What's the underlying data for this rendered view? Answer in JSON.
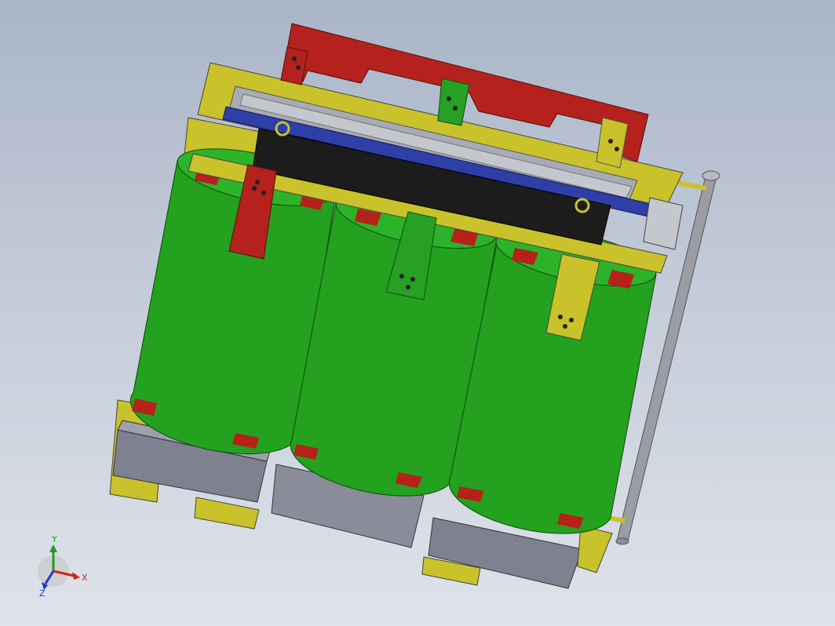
{
  "view": {
    "background_top": "#a9b5c7",
    "background_bottom": "#dfe3ea"
  },
  "model": {
    "colors": {
      "coil": "#23a11f",
      "coil_dark": "#157a14",
      "frame": "#c9c22a",
      "frame_dark": "#8f8a1a",
      "busbar_red": "#b5221d",
      "busbar_dark": "#7d1411",
      "clamp_black": "#1c1c1c",
      "blue_rail": "#2e3fa8",
      "core_grey": "#8f939c",
      "base_grey": "#7e8190",
      "pipe_grey": "#9a9da3",
      "spacer_red": "#b8201a"
    }
  },
  "triad": {
    "x_label": "X",
    "y_label": "Y",
    "z_label": "Z",
    "x_color": "#d42020",
    "y_color": "#1e9a1e",
    "z_color": "#2038c8"
  }
}
